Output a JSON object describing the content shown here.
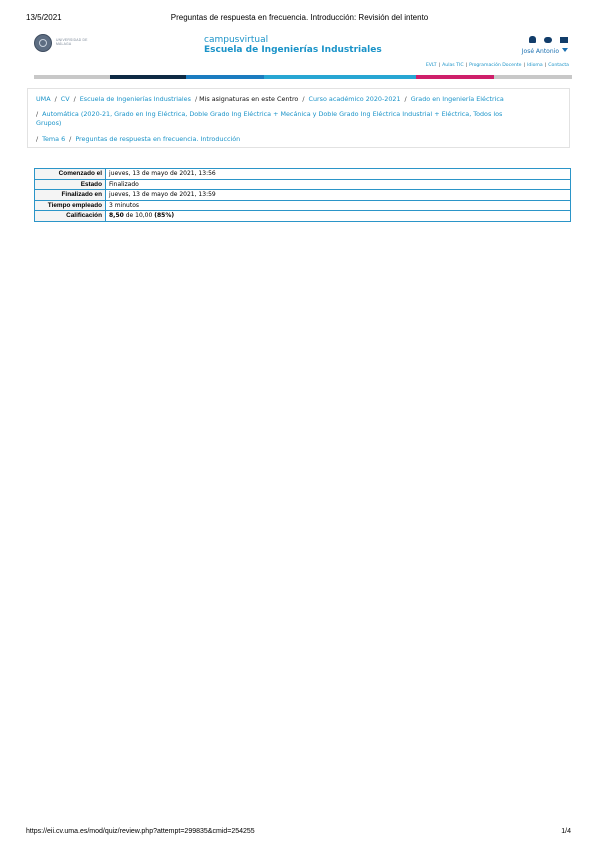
{
  "print": {
    "date": "13/5/2021",
    "title": "Preguntas de respuesta en frecuencia. Introducción: Revisión del intento",
    "url": "https://eii.cv.uma.es/mod/quiz/review.php?attempt=299835&cmid=254255",
    "page": "1/4"
  },
  "header": {
    "logo_text": "UNIVERSIDAD DE MÁLAGA",
    "site_name": "campusvirtual",
    "school": "Escuela de Ingenierías Industriales",
    "user_name": "José Antonio",
    "icons": [
      "bell-icon",
      "chat-icon",
      "mail-icon"
    ],
    "quick_links": [
      "EVLT",
      "Aulas TIC",
      "Programación Docente",
      "Idioma",
      "Contacta"
    ]
  },
  "color_bar": [
    "#c8c8c8",
    "#0e2a44",
    "#1b7cc0",
    "#27a6d3",
    "#ce1f6a",
    "#c8c8c8"
  ],
  "breadcrumb": {
    "line1": [
      "UMA",
      "CV",
      "Escuela de Ingenierías Industriales",
      "Mis asignaturas en este Centro",
      "Curso académico 2020-2021",
      "Grado en Ingeniería Eléctrica"
    ],
    "line2a": "Automática (2020-21, Grado en Ing Eléctrica, Doble Grado Ing Eléctrica + Mecánica y Doble Grado Ing Eléctrica Industrial + Eléctrica, Todos los",
    "line2b": "Grupos)",
    "line3": [
      "Tema 6",
      "Preguntas de respuesta en frecuencia. Introducción"
    ]
  },
  "summary": [
    {
      "label": "Comenzado el",
      "value": "jueves, 13 de mayo de 2021, 13:56"
    },
    {
      "label": "Estado",
      "value": "Finalizado"
    },
    {
      "label": "Finalizado en",
      "value": "jueves, 13 de mayo de 2021, 13:59"
    },
    {
      "label": "Tiempo empleado",
      "value": "3 minutos"
    },
    {
      "label": "Calificación",
      "grade": "8,50",
      "grade_of": "de 10,00",
      "percent": "(85%)"
    }
  ]
}
